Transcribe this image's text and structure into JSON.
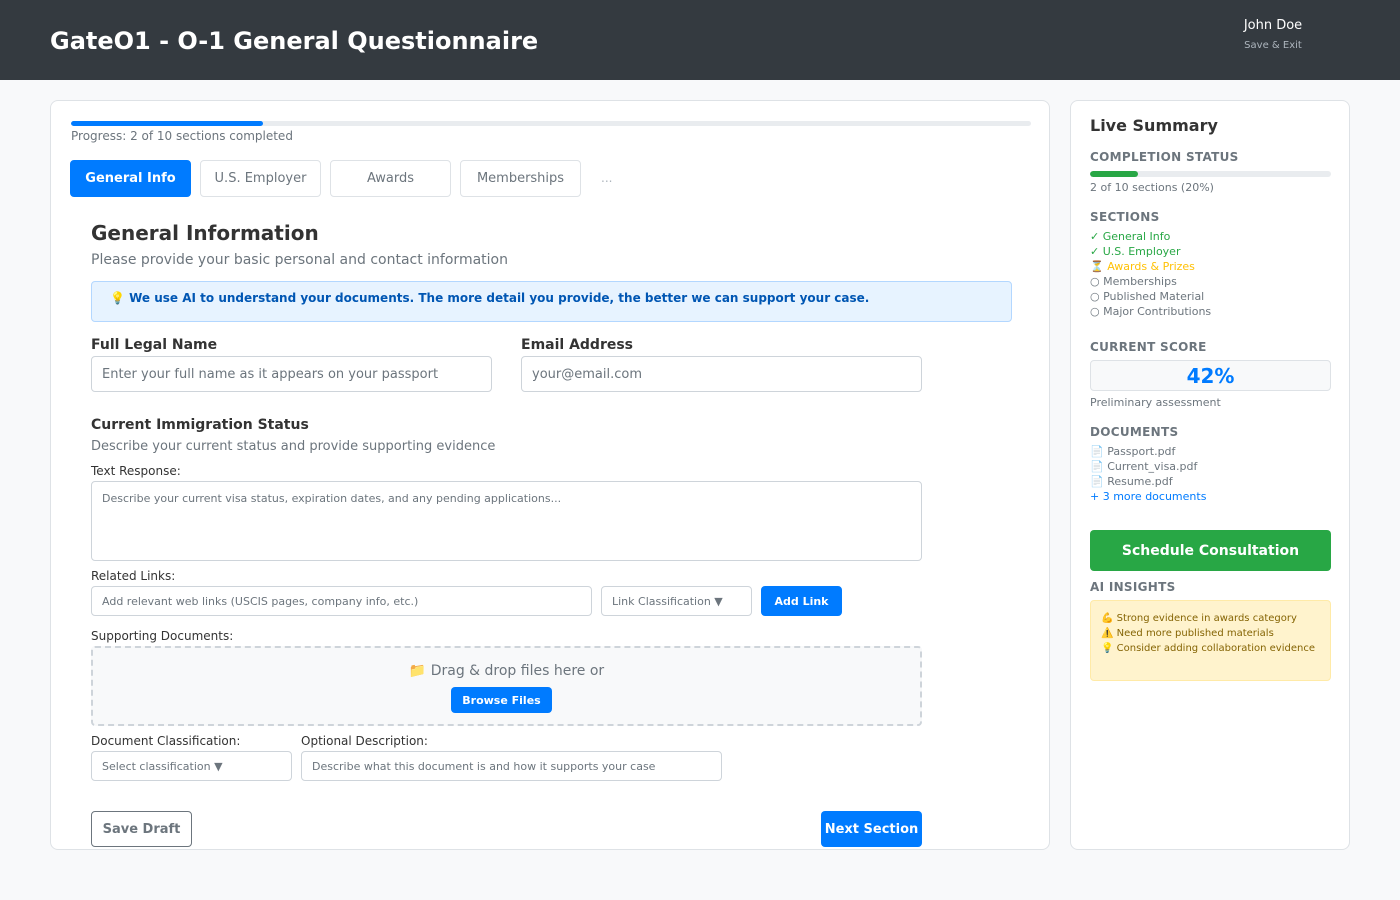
{
  "header": {
    "title": "GateO1 - O-1 General Questionnaire",
    "user_name": "John Doe",
    "save_exit": "Save & Exit"
  },
  "progress": {
    "completed": 2,
    "total": 10,
    "fraction": 0.2,
    "text": "Progress: 2 of 10 sections completed"
  },
  "tabs": [
    {
      "label": "General Info",
      "active": true
    },
    {
      "label": "U.S. Employer",
      "active": false
    },
    {
      "label": "Awards",
      "active": false
    },
    {
      "label": "Memberships",
      "active": false
    }
  ],
  "tabs_more": "...",
  "section": {
    "title": "General Information",
    "subtitle": "Please provide your basic personal and contact information",
    "ai_notice": "💡 We use AI to understand your documents. The more detail you provide, the better we can support your case."
  },
  "fields": {
    "full_name": {
      "label": "Full Legal Name",
      "placeholder": "Enter your full name as it appears on your passport"
    },
    "email": {
      "label": "Email Address",
      "placeholder": "your@email.com"
    }
  },
  "immigration": {
    "title": "Current Immigration Status",
    "description": "Describe your current status and provide supporting evidence",
    "text_response_label": "Text Response:",
    "text_placeholder": "Describe your current visa status, expiration dates, and any pending applications...",
    "related_links_label": "Related Links:",
    "link_placeholder": "Add relevant web links (USCIS pages, company info, etc.)",
    "link_classification": "Link Classification ▼",
    "add_link": "Add Link",
    "supporting_docs_label": "Supporting Documents:",
    "drop_text": "📁 Drag & drop files here or",
    "browse": "Browse Files",
    "doc_class_label": "Document Classification:",
    "doc_class_value": "Select classification ▼",
    "optional_desc_label": "Optional Description:",
    "optional_desc_placeholder": "Describe what this document is and how it supports your case"
  },
  "actions": {
    "save_draft": "Save Draft",
    "next_section": "Next Section"
  },
  "sidebar": {
    "title": "Live Summary",
    "completion_heading": "COMPLETION STATUS",
    "completion_fraction": 0.2,
    "completion_text": "2 of 10 sections (20%)",
    "sections_heading": "SECTIONS",
    "sections": [
      {
        "label": "✓ General Info",
        "color": "#28a745"
      },
      {
        "label": "✓ U.S. Employer",
        "color": "#28a745"
      },
      {
        "label": "⏳ Awards & Prizes",
        "color": "#ffc107"
      },
      {
        "label": "○ Memberships",
        "color": "#6c757d"
      },
      {
        "label": "○ Published Material",
        "color": "#6c757d"
      },
      {
        "label": "○ Major Contributions",
        "color": "#6c757d"
      }
    ],
    "score_heading": "CURRENT SCORE",
    "score": "42%",
    "score_note": "Preliminary assessment",
    "documents_heading": "DOCUMENTS",
    "documents": [
      "📄 Passport.pdf",
      "📄 Current_visa.pdf",
      "📄 Resume.pdf"
    ],
    "more_documents": "+ 3 more documents",
    "schedule": "Schedule Consultation",
    "insights_heading": "AI INSIGHTS",
    "insights": [
      "💪 Strong evidence in awards category",
      "⚠️ Need more published materials",
      "💡 Consider adding collaboration evidence"
    ]
  },
  "colors": {
    "primary": "#007bff",
    "success": "#28a745",
    "warning": "#ffc107",
    "header_bg": "#343a40"
  }
}
